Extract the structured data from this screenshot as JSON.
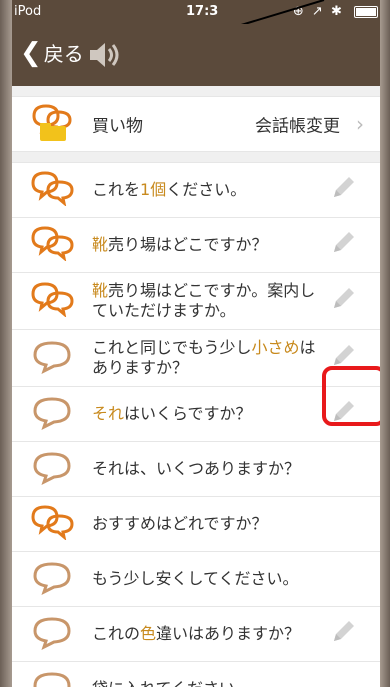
{
  "status": {
    "carrier": "iPod",
    "time": "17:3",
    "right_icons": "⊕ ↗ ✱"
  },
  "nav": {
    "back_label": "戻る",
    "speaker_icon": "speaker-icon"
  },
  "header": {
    "category": "買い物",
    "change_label": "会話帳変更",
    "arrow": "›"
  },
  "phrases": [
    {
      "pre": "これを",
      "hl": "1",
      "mid": "",
      "hl2": "個",
      "post": "ください。",
      "pencil": true,
      "filled": true
    },
    {
      "pre": "",
      "hl": "靴",
      "mid": "売り場はどこですか？",
      "hl2": "",
      "post": "",
      "pencil": true,
      "filled": true
    },
    {
      "pre": "",
      "hl": "靴",
      "mid": "売り場はどこですか。案内していただけますか。",
      "hl2": "",
      "post": "",
      "pencil": true,
      "filled": true
    },
    {
      "pre": "これと同じでもう少し",
      "hl": "小さめ",
      "mid": "はありますか？",
      "hl2": "",
      "post": "",
      "pencil": true,
      "filled": false
    },
    {
      "pre": "",
      "hl": "それ",
      "mid": "はいくらですか？",
      "hl2": "",
      "post": "",
      "pencil": true,
      "filled": false
    },
    {
      "pre": "それは、いくつありますか？",
      "hl": "",
      "mid": "",
      "hl2": "",
      "post": "",
      "pencil": false,
      "filled": false
    },
    {
      "pre": "おすすめはどれですか？",
      "hl": "",
      "mid": "",
      "hl2": "",
      "post": "",
      "pencil": false,
      "filled": true
    },
    {
      "pre": "もう少し安くしてください。",
      "hl": "",
      "mid": "",
      "hl2": "",
      "post": "",
      "pencil": false,
      "filled": false
    },
    {
      "pre": "これの",
      "hl": "色",
      "mid": "違いはありますか？",
      "hl2": "",
      "post": "",
      "pencil": true,
      "filled": false
    },
    {
      "pre": "袋に入れてください。",
      "hl": "",
      "mid": "",
      "hl2": "",
      "post": "",
      "pencil": false,
      "filled": false
    }
  ],
  "colors": {
    "nav_bg": "#5b4a3b",
    "accent": "#c88a1e",
    "bubble_filled": "#e27a1b",
    "bubble_outline": "#c8966a",
    "highlight": "#e8191b"
  }
}
